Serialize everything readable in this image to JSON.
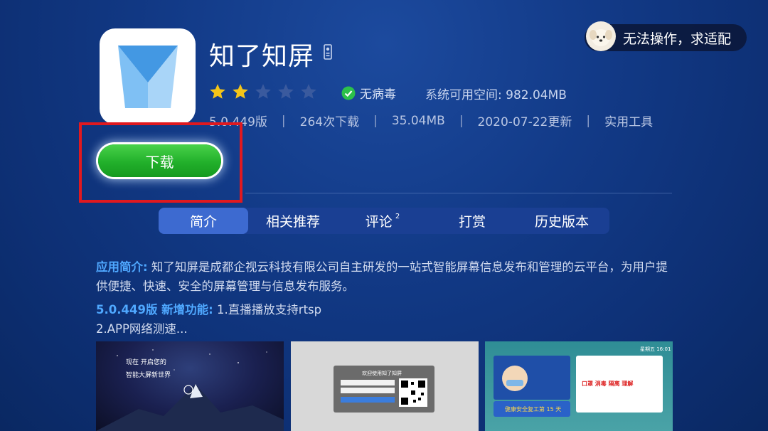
{
  "app": {
    "title": "知了知屏",
    "rating_stars_filled": 2,
    "rating_stars_total": 5,
    "virus_label": "无病毒",
    "space_text": "系统可用空间: 982.04MB",
    "version": "5.0.449版",
    "downloads": "264次下载",
    "size": "35.04MB",
    "updated": "2020-07-22更新",
    "category": "实用工具",
    "download_label": "下载"
  },
  "notice": {
    "text": "无法操作，求适配"
  },
  "tabs": [
    {
      "label": "简介",
      "active": true,
      "badge": ""
    },
    {
      "label": "相关推荐",
      "active": false,
      "badge": ""
    },
    {
      "label": "评论",
      "active": false,
      "badge": "2"
    },
    {
      "label": "打赏",
      "active": false,
      "badge": ""
    },
    {
      "label": "历史版本",
      "active": false,
      "badge": ""
    }
  ],
  "description": {
    "intro_label": "应用简介:",
    "intro_text": " 知了知屏是成都企视云科技有限公司自主研发的一站式智能屏幕信息发布和管理的云平台，为用户提供便捷、快速、安全的屏幕管理与信息发布服务。",
    "features_label": "5.0.449版 新增功能:",
    "features_text": " 1.直播播放支持rtsp",
    "features_more": "2.APP网络测速..."
  },
  "screenshots": {
    "shot1": {
      "line1": "现在 开启您的",
      "line2": "智能大屏新世界"
    },
    "shot2": {
      "title": "欢迎使用知了知屏"
    },
    "shot3": {
      "headline": "口罩  消毒  隔离  理解",
      "banner": "健康安全复工第 15 天",
      "time": "星期五  16:01"
    }
  },
  "colors": {
    "background": "#123a87",
    "accent_blue": "#4fa8ff",
    "download_green": "#22b02b",
    "focus_red": "#e0191f",
    "star_gold": "#f5c518"
  }
}
